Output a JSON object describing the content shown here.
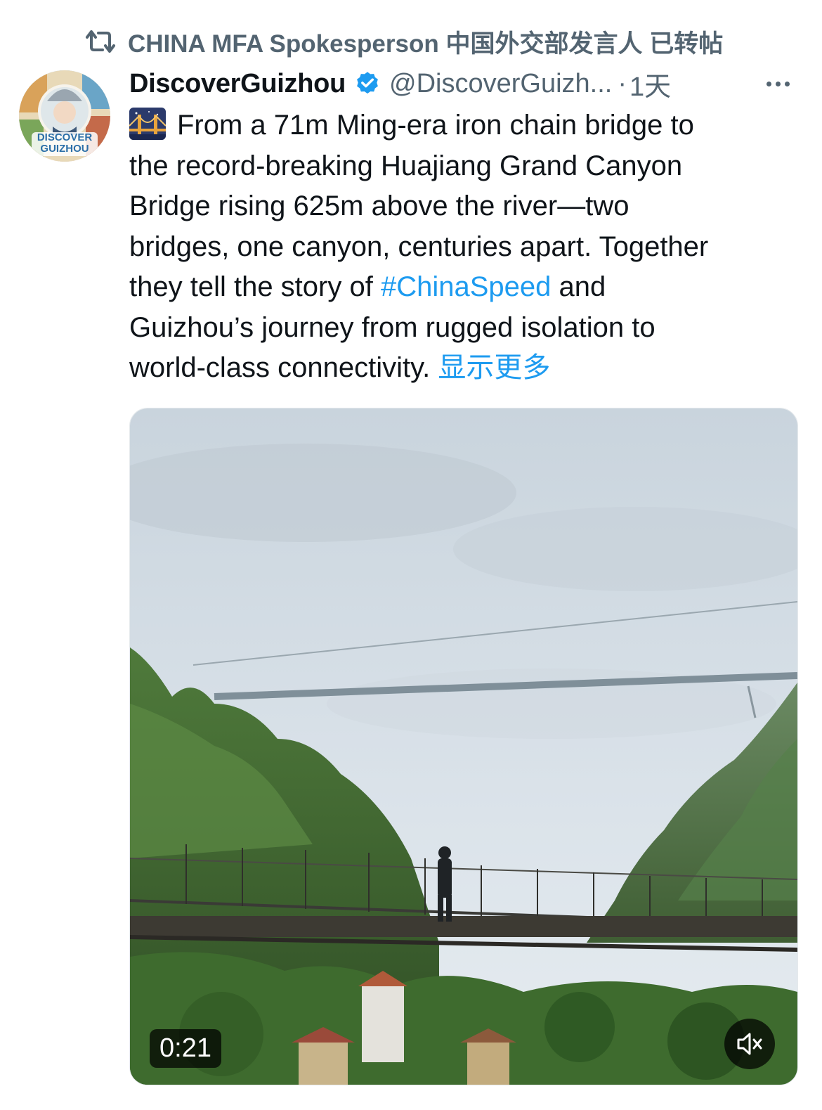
{
  "repost": {
    "icon": "repost-icon",
    "label": "CHINA MFA Spokesperson 中国外交部发言人 已转帖"
  },
  "author": {
    "avatar_icon": "discover-guizhou-avatar",
    "avatar_text_line1": "DISCOVER",
    "avatar_text_line2": "GUIZHOU",
    "display_name": "DiscoverGuizhou",
    "verified_icon": "verified-badge-icon",
    "handle": "@DiscoverGuizh...",
    "separator": "·",
    "time": "1天",
    "more_icon": "more-horizontal-icon"
  },
  "post": {
    "emoji": "bridge-at-night-emoji",
    "text_part1": "From a 71m Ming-era iron chain bridge to\nthe record-breaking Huajiang Grand Canyon\nBridge rising 625m above the river—two\nbridges, one canyon, centuries apart. Together\nthey tell the story of ",
    "hashtag": "#ChinaSpeed",
    "text_part2": " and\nGuizhou’s journey from rugged isolation to\nworld-class connectivity. ",
    "show_more": "显示更多"
  },
  "media": {
    "type": "video",
    "duration": "0:21",
    "mute_icon": "speaker-muted-icon"
  },
  "colors": {
    "accent": "#1d9bf0",
    "secondary_text": "#536471",
    "primary_text": "#0f1419"
  }
}
